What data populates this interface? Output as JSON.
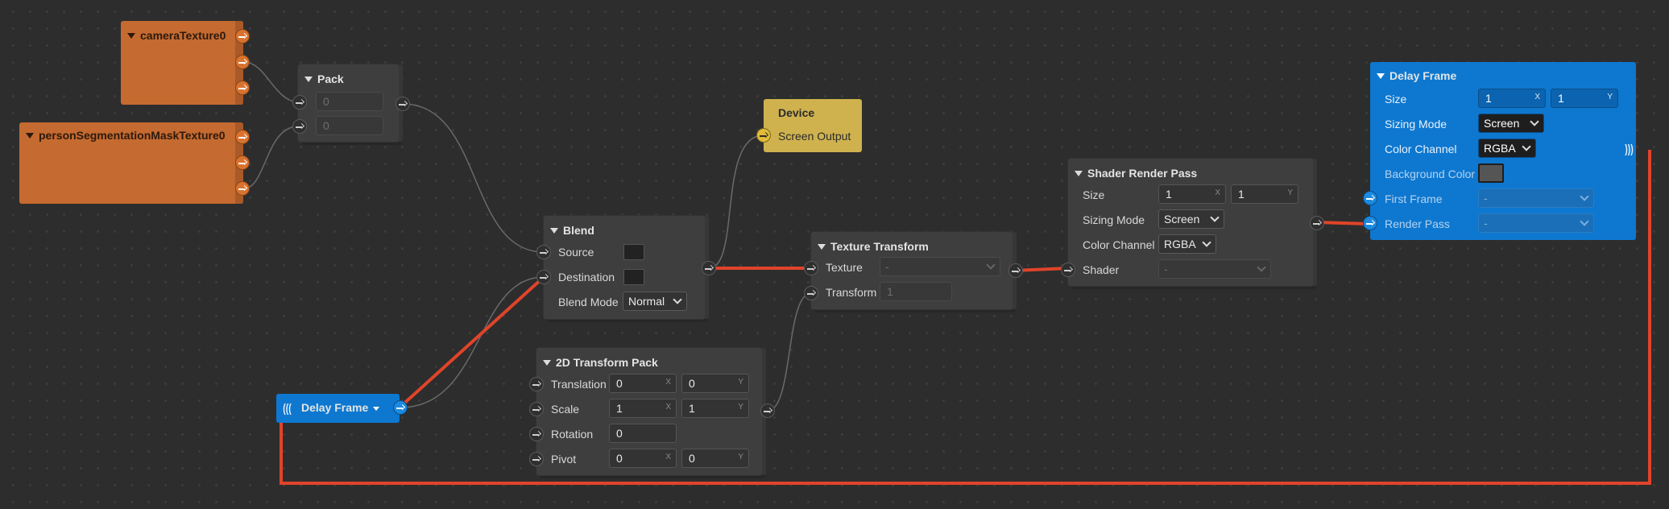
{
  "nodes": {
    "camera": {
      "title": "cameraTexture0"
    },
    "person": {
      "title": "personSegmentationMaskTexture0"
    },
    "pack": {
      "title": "Pack",
      "in1": "0",
      "in2": "0"
    },
    "device": {
      "title": "Device",
      "port_label": "Screen Output"
    },
    "blend": {
      "title": "Blend",
      "source_label": "Source",
      "destination_label": "Destination",
      "mode_label": "Blend Mode",
      "mode_value": "Normal"
    },
    "texture_transform": {
      "title": "Texture Transform",
      "texture_label": "Texture",
      "texture_value": "-",
      "transform_label": "Transform",
      "transform_value": "1"
    },
    "transform_pack": {
      "title": "2D Transform Pack",
      "translation_label": "Translation",
      "translation_x": "0",
      "translation_y": "0",
      "scale_label": "Scale",
      "scale_x": "1",
      "scale_y": "1",
      "rotation_label": "Rotation",
      "rotation": "0",
      "pivot_label": "Pivot",
      "pivot_x": "0",
      "pivot_y": "0"
    },
    "shader_pass": {
      "title": "Shader Render Pass",
      "size_label": "Size",
      "size_x": "1",
      "size_y": "1",
      "sizing_mode_label": "Sizing Mode",
      "sizing_mode": "Screen",
      "color_channel_label": "Color Channel",
      "color_channel": "RGBA",
      "shader_label": "Shader",
      "shader_value": "-"
    },
    "delay_frame": {
      "title": "Delay Frame",
      "size_label": "Size",
      "size_x": "1",
      "size_y": "1",
      "sizing_mode_label": "Sizing Mode",
      "sizing_mode": "Screen",
      "color_channel_label": "Color Channel",
      "color_channel": "RGBA",
      "background_color_label": "Background Color",
      "first_frame_label": "First Frame",
      "first_frame_value": "-",
      "render_pass_label": "Render Pass",
      "render_pass_value": "-"
    },
    "delay_frame_ref": {
      "title": "Delay Frame"
    }
  },
  "axis_labels": {
    "x": "X",
    "y": "Y"
  },
  "colors": {
    "canvas": "#2d2d2d",
    "node_gray": "#3e3e3e",
    "texture_orange": "#c56a30",
    "device_yellow": "#cfb24e",
    "delay_blue": "#0e78d0",
    "active_wire": "#e0442a",
    "inactive_wire": "#6a6a6a"
  },
  "icons": {
    "port": "arrow-right-circle-icon",
    "collapse": "triangle-down-icon",
    "dropdown": "chevron-down-icon",
    "delay_link": "wave-signal-icon"
  }
}
